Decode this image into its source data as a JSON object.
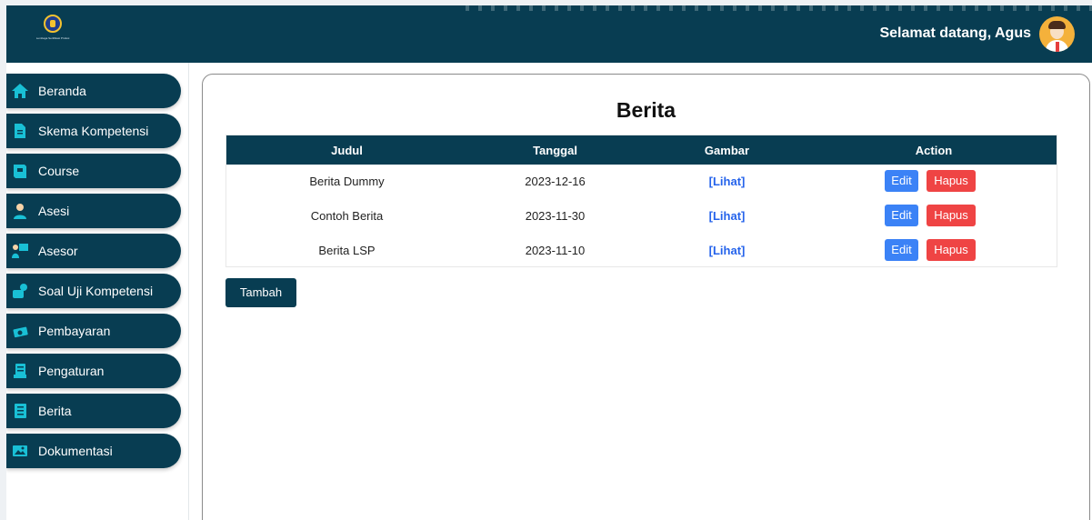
{
  "header": {
    "logo_text": "Lembaga Sertifikasi Profesi",
    "welcome": "Selamat datang, Agus"
  },
  "sidebar": {
    "items": [
      {
        "label": "Beranda",
        "icon": "home-icon"
      },
      {
        "label": "Skema Kompetensi",
        "icon": "document-icon"
      },
      {
        "label": "Course",
        "icon": "book-icon"
      },
      {
        "label": "Asesi",
        "icon": "person-icon"
      },
      {
        "label": "Asesor",
        "icon": "presenter-icon"
      },
      {
        "label": "Soal Uji Kompetensi",
        "icon": "quiz-icon"
      },
      {
        "label": "Pembayaran",
        "icon": "money-icon"
      },
      {
        "label": "Pengaturan",
        "icon": "settings-icon"
      },
      {
        "label": "Berita",
        "icon": "news-icon"
      },
      {
        "label": "Dokumentasi",
        "icon": "image-icon"
      }
    ]
  },
  "main": {
    "title": "Berita",
    "columns": [
      "Judul",
      "Tanggal",
      "Gambar",
      "Action"
    ],
    "rows": [
      {
        "judul": "Berita Dummy",
        "tanggal": "2023-12-16",
        "gambar": "[Lihat]",
        "edit": "Edit",
        "hapus": "Hapus"
      },
      {
        "judul": "Contoh Berita",
        "tanggal": "2023-11-30",
        "gambar": "[Lihat]",
        "edit": "Edit",
        "hapus": "Hapus"
      },
      {
        "judul": "Berita LSP",
        "tanggal": "2023-11-10",
        "gambar": "[Lihat]",
        "edit": "Edit",
        "hapus": "Hapus"
      }
    ],
    "add_button": "Tambah"
  },
  "colors": {
    "primary": "#083d52",
    "icon_accent": "#19c0d6",
    "edit": "#3b82f6",
    "delete": "#ef4444",
    "link": "#2563eb"
  }
}
